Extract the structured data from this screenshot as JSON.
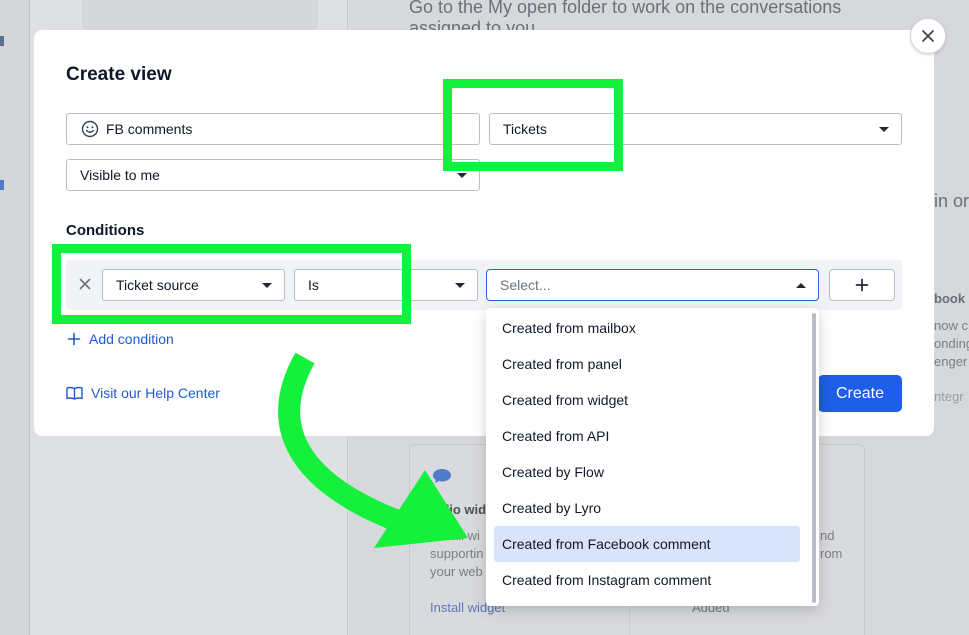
{
  "background": {
    "heading_line1": "Go to the My open folder to work on the conversations",
    "heading_line2": "assigned to you",
    "partial_in_or": "in or",
    "partial_book": "book",
    "partial_now": "now c",
    "partial_onding": "onding",
    "partial_enge": "enger",
    "partial_integr": "ntegr",
    "card_title": "Tidio wid",
    "card_line1": "Install wi",
    "card_line2": "supportin",
    "card_line3": "your web",
    "card_link": "Install widget",
    "card2_line1": "nd",
    "card2_line2": "rom",
    "card2_status": "Added"
  },
  "modal": {
    "title": "Create view",
    "name_value": "FB comments",
    "type_value": "Tickets",
    "visibility_value": "Visible to me",
    "conditions_label": "Conditions",
    "condition": {
      "field": "Ticket source",
      "operator": "Is",
      "value_placeholder": "Select..."
    },
    "add_condition": "Add condition",
    "help_link": "Visit our Help Center",
    "create_button": "Create"
  },
  "dropdown": {
    "options": [
      "Created from mailbox",
      "Created from panel",
      "Created from widget",
      "Created from API",
      "Created by Flow",
      "Created by Lyro",
      "Created from Facebook comment",
      "Created from Instagram comment"
    ],
    "selected_index": 6
  },
  "colors": {
    "accent": "#1f5ee8",
    "link": "#1f5bd1",
    "highlight_annotation": "#14f03c",
    "selected_option": "#d9e4fb"
  },
  "icons": [
    "smiley-icon",
    "caret-down-icon",
    "caret-up-icon",
    "close-icon",
    "plus-icon",
    "book-icon",
    "chat-icon"
  ]
}
